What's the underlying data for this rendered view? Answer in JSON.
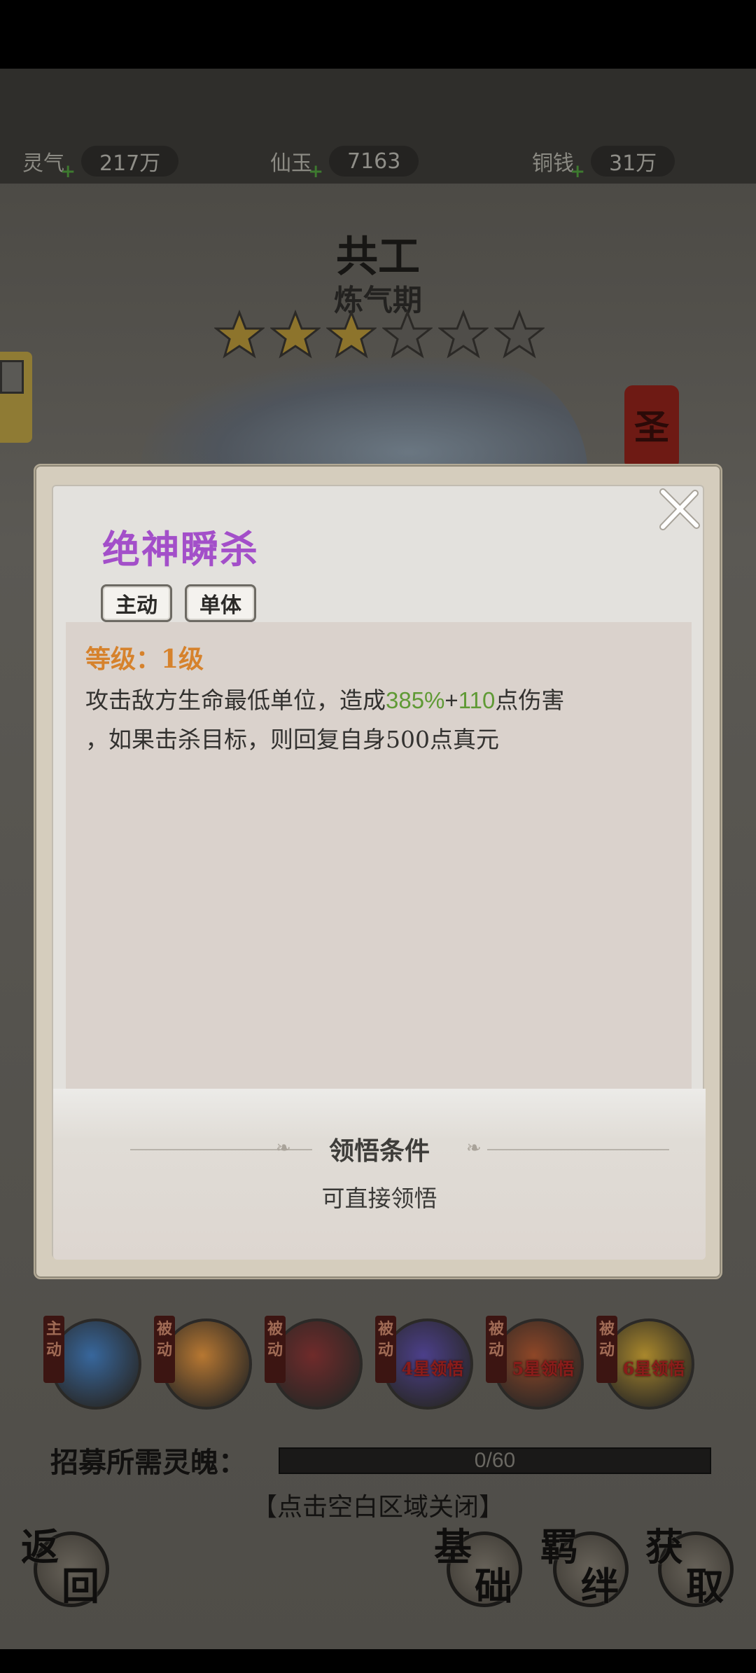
{
  "resources": [
    {
      "label": "灵气",
      "value": "217万"
    },
    {
      "label": "仙玉",
      "value": "7163"
    },
    {
      "label": "铜钱",
      "value": "31万"
    }
  ],
  "hero": {
    "name": "共工",
    "realm": "炼气期",
    "stars_filled": 3,
    "stars_total": 6,
    "seal": "圣"
  },
  "popup": {
    "skill_name": "绝神瞬杀",
    "tags": [
      "主动",
      "单体"
    ],
    "level": "等级：1级",
    "desc": {
      "p1": "攻击敌方生命最低单位，造成",
      "v1": "385%",
      "plus": "+",
      "v2": "110",
      "p2": "点伤害",
      "line2": "，如果击杀目标，则回复自身500点真元"
    },
    "condition_title": "领悟条件",
    "condition_text": "可直接领悟"
  },
  "skills": [
    {
      "ribbon": "主动",
      "lock": "",
      "color": "#2f6fb8"
    },
    {
      "ribbon": "被动",
      "lock": "",
      "color": "#d9852a"
    },
    {
      "ribbon": "被动",
      "lock": "",
      "color": "#7a1f20"
    },
    {
      "ribbon": "被动",
      "lock": "4星领悟",
      "color": "#4a3aa0"
    },
    {
      "ribbon": "被动",
      "lock": "5星领悟",
      "color": "#a3441c"
    },
    {
      "ribbon": "被动",
      "lock": "6星领悟",
      "color": "#c69a22"
    }
  ],
  "recruit": {
    "label": "招募所需灵魄：",
    "progress_text": "0/60",
    "progress": 0
  },
  "hint": "【点击空白区域关闭】",
  "nav": {
    "back": [
      "返",
      "回"
    ],
    "base": [
      "基",
      "础"
    ],
    "bond": [
      "羁",
      "绊"
    ],
    "obtain": [
      "获",
      "取"
    ]
  }
}
